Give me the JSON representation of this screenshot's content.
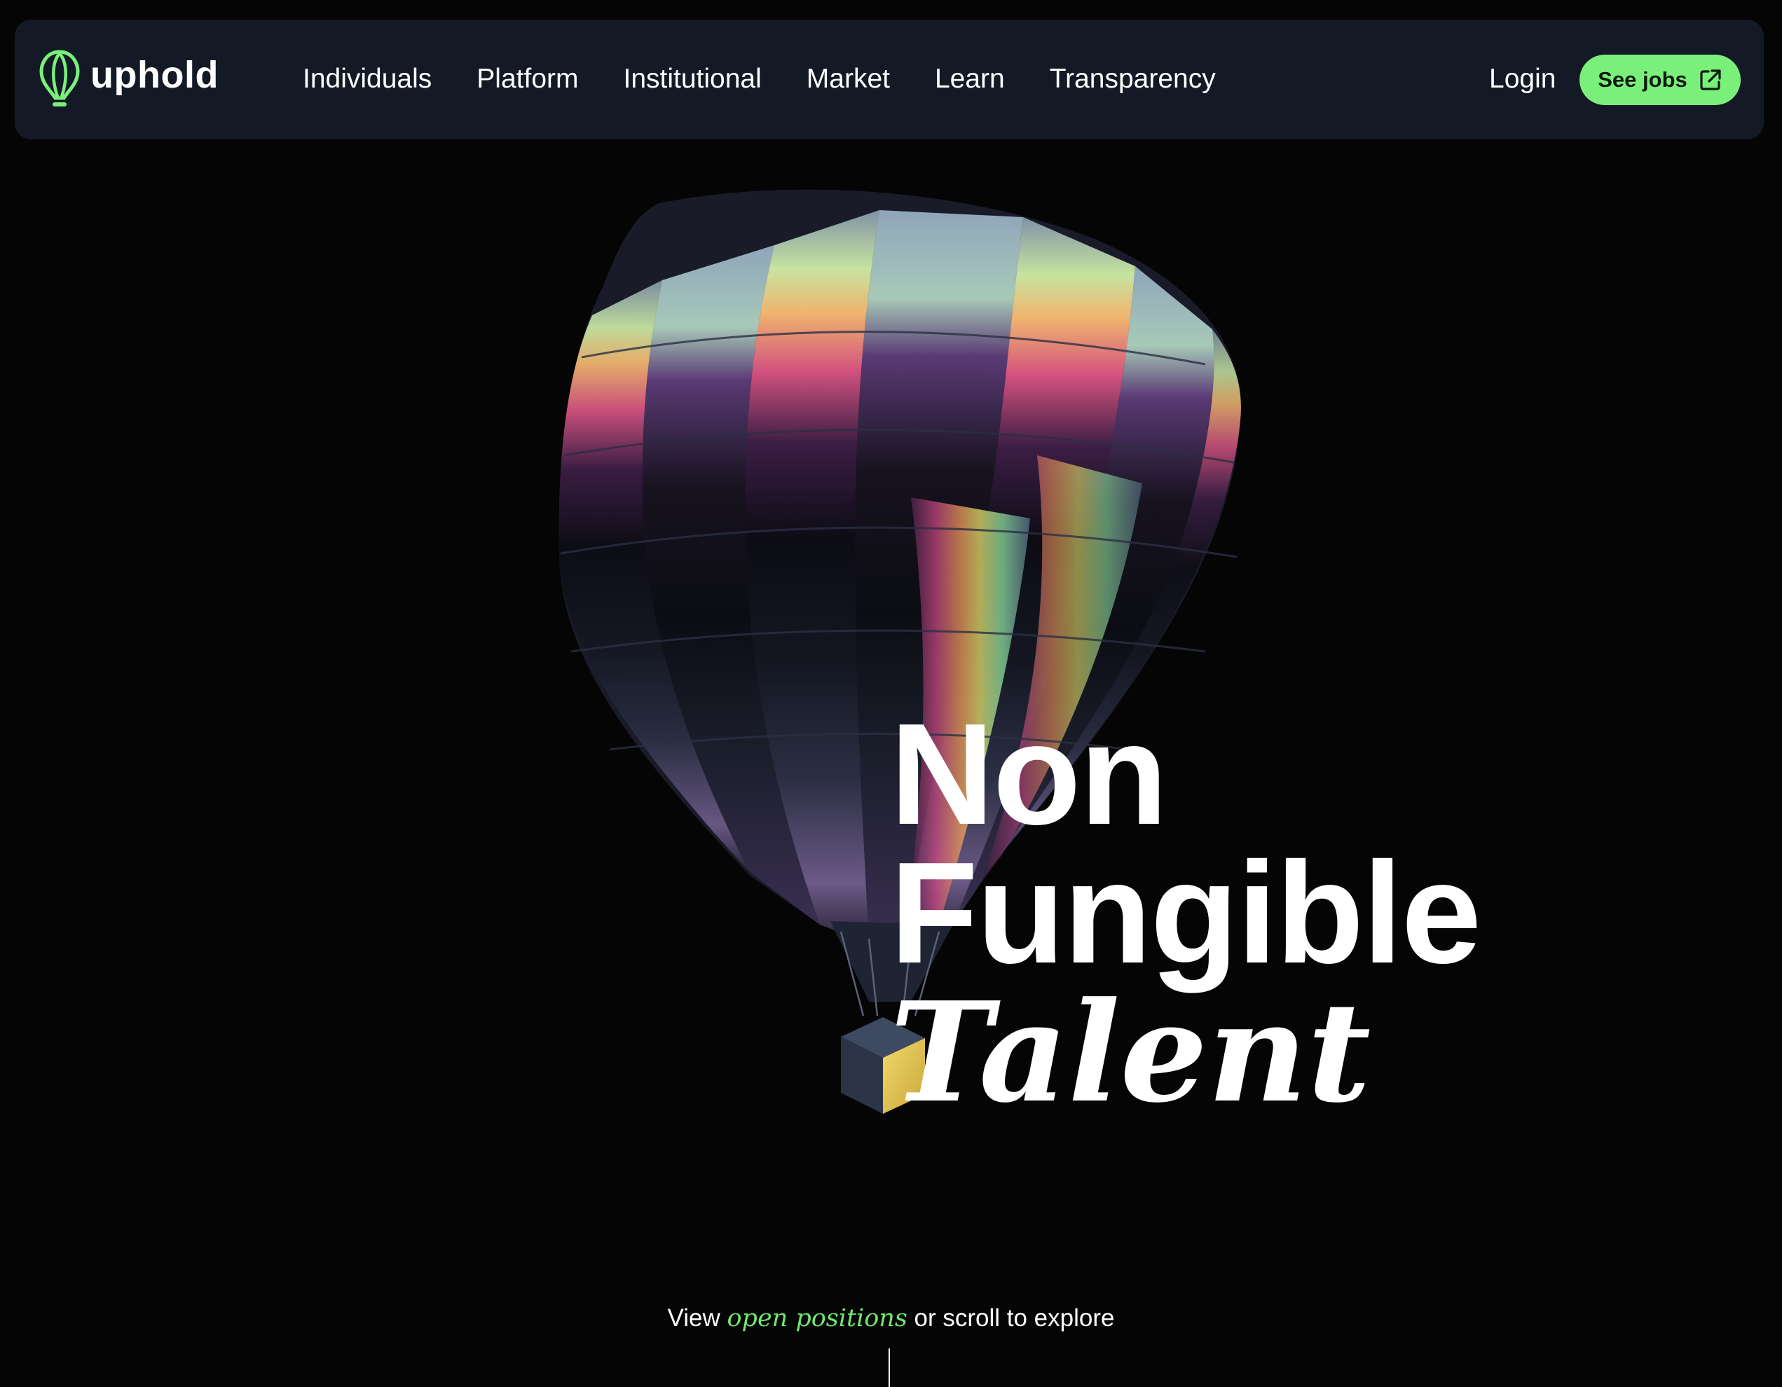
{
  "brand": {
    "name": "uphold",
    "accent_color": "#7af07a",
    "nav_background": "#131a26",
    "page_background": "#050505"
  },
  "nav": {
    "logo_icon": "uphold-balloon-logo-icon",
    "links": [
      {
        "label": "Individuals"
      },
      {
        "label": "Platform"
      },
      {
        "label": "Institutional"
      },
      {
        "label": "Market"
      },
      {
        "label": "Learn"
      },
      {
        "label": "Transparency"
      }
    ],
    "login_label": "Login",
    "cta_label": "See jobs",
    "cta_icon": "external-link-icon"
  },
  "hero": {
    "image": "hot-air-balloon-illustration",
    "headline_line1": "Non",
    "headline_line2": "Fungible",
    "headline_line3": "Talent"
  },
  "footer_prompt": {
    "prefix": "View",
    "link_text": "open positions",
    "suffix": "or scroll to explore"
  }
}
